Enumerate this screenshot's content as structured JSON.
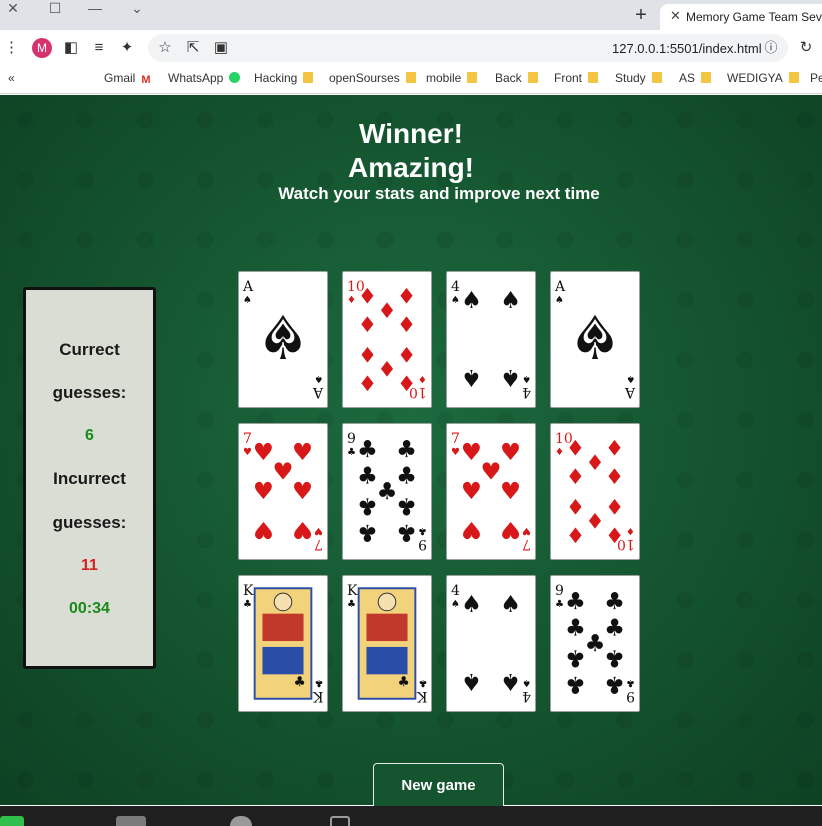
{
  "browser": {
    "tab_title": "Memory Game Team Seven",
    "url": "127.0.0.1:5501/index.html",
    "avatar_letter": "M",
    "bookmarks": [
      "Gmail",
      "WhatsApp",
      "Hacking",
      "openSourses",
      "mobile",
      "Back",
      "Front",
      "Study",
      "AS",
      "WEDIGYA",
      "Pe"
    ]
  },
  "game": {
    "title_line1": "Winner!",
    "title_line2": "Amazing!",
    "subtitle": "Watch your stats and improve next time",
    "stats": {
      "correct_label_1": "Currect",
      "correct_label_2": "guesses:",
      "correct_value": "6",
      "incorrect_label_1": "Incurrect",
      "incorrect_label_2": "guesses:",
      "incorrect_value": "11",
      "timer": "00:34"
    },
    "cards": [
      {
        "rank": "A",
        "suit": "spades",
        "color": "#111111"
      },
      {
        "rank": "10",
        "suit": "diamonds",
        "color": "#d81818"
      },
      {
        "rank": "4",
        "suit": "spades",
        "color": "#111111"
      },
      {
        "rank": "A",
        "suit": "spades",
        "color": "#111111"
      },
      {
        "rank": "7",
        "suit": "hearts",
        "color": "#d81818"
      },
      {
        "rank": "9",
        "suit": "clubs",
        "color": "#111111"
      },
      {
        "rank": "7",
        "suit": "hearts",
        "color": "#d81818"
      },
      {
        "rank": "10",
        "suit": "diamonds",
        "color": "#d81818"
      },
      {
        "rank": "K",
        "suit": "clubs",
        "color": "#111111"
      },
      {
        "rank": "K",
        "suit": "clubs",
        "color": "#111111"
      },
      {
        "rank": "4",
        "suit": "spades",
        "color": "#111111"
      },
      {
        "rank": "9",
        "suit": "clubs",
        "color": "#111111"
      }
    ],
    "new_game_label": "New game"
  }
}
